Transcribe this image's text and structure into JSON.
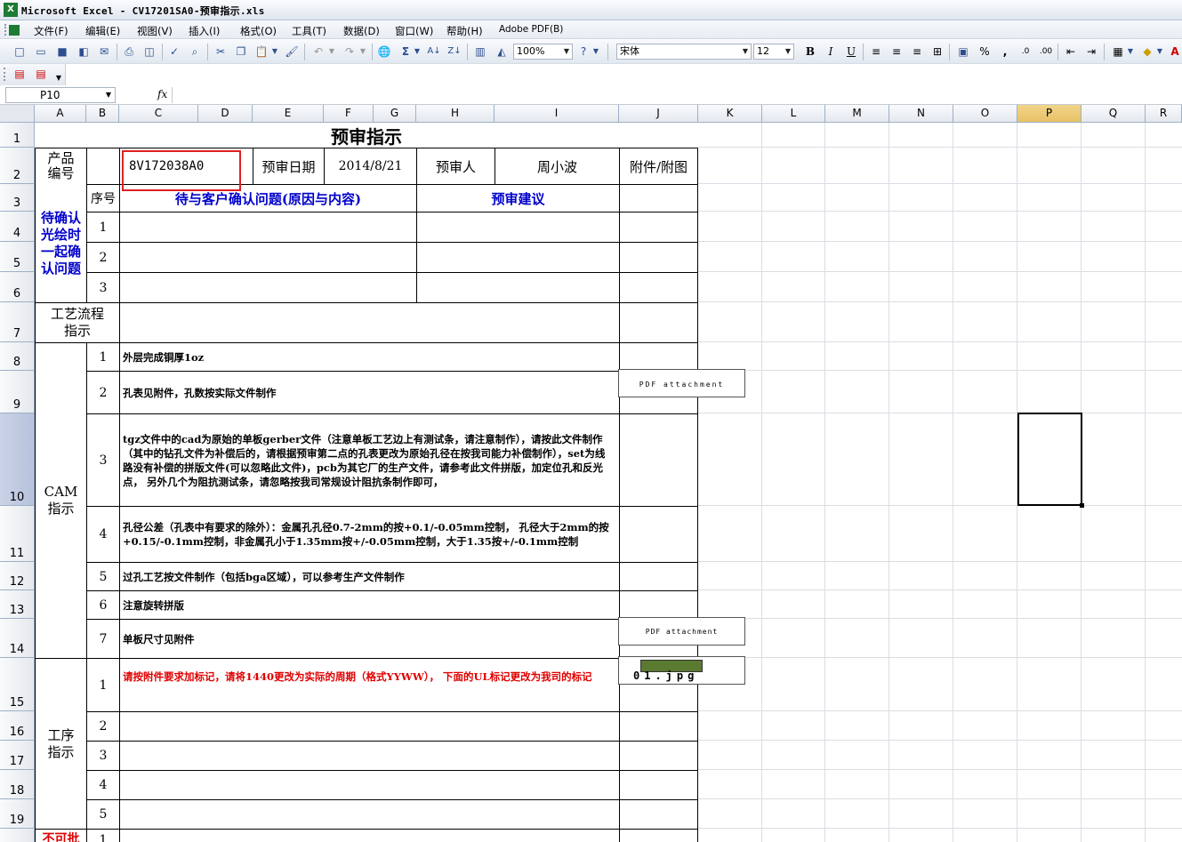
{
  "window": {
    "title": "Microsoft Excel - CV17201SA0-预审指示.xls"
  },
  "menu": {
    "items": [
      "文件(F)",
      "编辑(E)",
      "视图(V)",
      "插入(I)",
      "格式(O)",
      "工具(T)",
      "数据(D)",
      "窗口(W)",
      "帮助(H)",
      "Adobe PDF(B)"
    ]
  },
  "toolbar": {
    "zoom": "100%",
    "font_name": "宋体",
    "font_size": "12",
    "bold": "B",
    "italic": "I",
    "underline": "U",
    "percent": "%",
    "comma": ","
  },
  "formula_bar": {
    "cell_ref": "P10",
    "fx": "fx",
    "formula": ""
  },
  "columns": [
    "A",
    "B",
    "C",
    "D",
    "E",
    "F",
    "G",
    "H",
    "I",
    "J",
    "K",
    "L",
    "M",
    "N",
    "O",
    "P",
    "Q",
    "R"
  ],
  "rows": [
    "1",
    "2",
    "3",
    "4",
    "5",
    "6",
    "7",
    "8",
    "9",
    "10",
    "11",
    "12",
    "13",
    "14",
    "15",
    "16",
    "17",
    "18",
    "19"
  ],
  "sheet": {
    "title": "预审指示",
    "product_label": "产品\n编号",
    "product_no": "8V172038A0",
    "review_date_label": "预审日期",
    "review_date": "2014/8/21",
    "reviewer_label": "预审人",
    "reviewer": "周小波",
    "attach_label": "附件/附图",
    "seq_label": "序号",
    "issue_header": "待与客户确认问题(原因与内容)",
    "advice_header": "预审建议",
    "pending_label": "待确认\n光绘时\n一起确\n认问题",
    "pending_nums": [
      "1",
      "2",
      "3"
    ],
    "process_label": "工艺流程\n指示",
    "cam_label": "CAM\n指示",
    "cam_items": [
      {
        "no": "1",
        "text": "外层完成铜厚1oz"
      },
      {
        "no": "2",
        "text": "孔表见附件，孔数按实际文件制作"
      },
      {
        "no": "3",
        "text": "tgz文件中的cad为原始的单板gerber文件（注意单板工艺边上有测试条，请注意制作），请按此文件制作（其中的钻孔文件为补偿后的，请根据预审第二点的孔表更改为原始孔径在按我司能力补偿制作），set为线路没有补偿的拼版文件(可以忽略此文件)，pcb为其它厂的生产文件，请参考此文件拼版，加定位孔和反光点， 另外几个为阻抗测试条，请忽略按我司常规设计阻抗条制作即可，"
      },
      {
        "no": "4",
        "text": "孔径公差（孔表中有要求的除外）：金属孔孔径0.7-2mm的按+0.1/-0.05mm控制， 孔径大于2mm的按+0.15/-0.1mm控制，非金属孔小于1.35mm按+/-0.05mm控制，大于1.35按+/-0.1mm控制"
      },
      {
        "no": "5",
        "text": "过孔工艺按文件制作（包括bga区域），可以参考生产文件制作"
      },
      {
        "no": "6",
        "text": "注意旋转拼版"
      },
      {
        "no": "7",
        "text": "单板尺寸见附件"
      }
    ],
    "proc_label": "工序\n指示",
    "proc_items": [
      {
        "no": "1",
        "text": "请按附件要求加标记，请将1440更改为实际的周期（格式YYWW），  下面的UL标记更改为我司的标记"
      },
      {
        "no": "2",
        "text": ""
      },
      {
        "no": "3",
        "text": ""
      },
      {
        "no": "4",
        "text": ""
      },
      {
        "no": "5",
        "text": ""
      }
    ],
    "bottom_label": "不可批",
    "bottom_no": "1",
    "attach_files": [
      "PDF attachment",
      "PDF attachment",
      "01.jpg"
    ]
  }
}
